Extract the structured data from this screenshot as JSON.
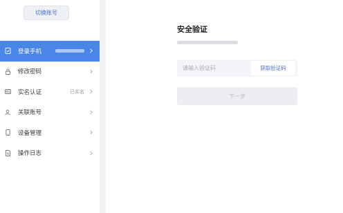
{
  "sidebar": {
    "switch_account_label": "切换账号",
    "items": [
      {
        "label": "登录手机",
        "icon": "phone-check-icon",
        "active": true,
        "value_masked": true
      },
      {
        "label": "修改密码",
        "icon": "lock-icon",
        "active": false
      },
      {
        "label": "实名认证",
        "icon": "id-card-icon",
        "active": false,
        "status": "已实名"
      },
      {
        "label": "关联账号",
        "icon": "user-link-icon",
        "active": false
      },
      {
        "label": "设备管理",
        "icon": "device-icon",
        "active": false
      },
      {
        "label": "操作日志",
        "icon": "log-icon",
        "active": false
      }
    ]
  },
  "main": {
    "title": "安全验证",
    "code_input": {
      "placeholder": "请输入验证码",
      "value": ""
    },
    "get_code_label": "获取验证码",
    "next_label": "下一步"
  },
  "colors": {
    "accent": "#4a86e8",
    "link": "#4a6fd8"
  }
}
